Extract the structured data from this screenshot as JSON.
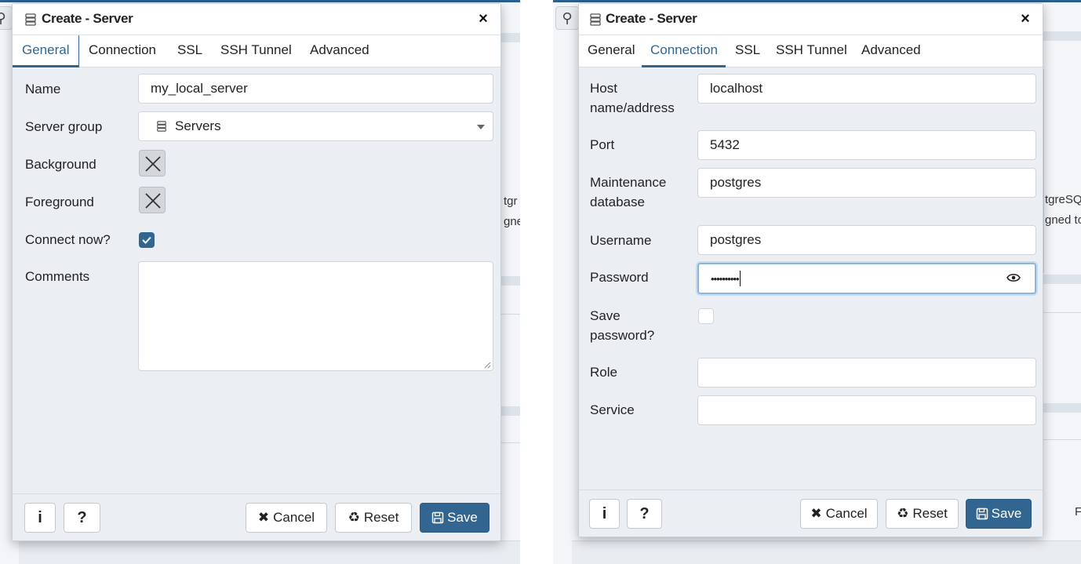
{
  "background": {
    "left_fragments": [
      "tgr",
      "gne"
    ],
    "right_fragments": [
      "tgreSQ",
      "gned to",
      "F"
    ]
  },
  "left_dialog": {
    "title": "Create - Server",
    "close_glyph": "×",
    "tabs": [
      "General",
      "Connection",
      "SSL",
      "SSH Tunnel",
      "Advanced"
    ],
    "active_tab": "General",
    "fields": {
      "name_label": "Name",
      "name_value": "my_local_server",
      "server_group_label": "Server group",
      "server_group_value": "Servers",
      "background_label": "Background",
      "foreground_label": "Foreground",
      "connect_now_label": "Connect now?",
      "connect_now_checked": true,
      "comments_label": "Comments",
      "comments_value": ""
    },
    "footer": {
      "info_label": "i",
      "help_label": "?",
      "cancel_label": "Cancel",
      "reset_label": "Reset",
      "save_label": "Save"
    }
  },
  "right_dialog": {
    "title": "Create - Server",
    "close_glyph": "×",
    "tabs": [
      "General",
      "Connection",
      "SSL",
      "SSH Tunnel",
      "Advanced"
    ],
    "active_tab": "Connection",
    "fields": {
      "host_label_1": "Host",
      "host_label_2": "name/address",
      "host_value": "localhost",
      "port_label": "Port",
      "port_value": "5432",
      "maint_label_1": "Maintenance",
      "maint_label_2": "database",
      "maint_value": "postgres",
      "username_label": "Username",
      "username_value": "postgres",
      "password_label": "Password",
      "password_value": "••••••••••",
      "save_pw_label_1": "Save",
      "save_pw_label_2": "password?",
      "save_password_checked": false,
      "role_label": "Role",
      "role_value": "",
      "service_label": "Service",
      "service_value": ""
    },
    "footer": {
      "info_label": "i",
      "help_label": "?",
      "cancel_label": "Cancel",
      "reset_label": "Reset",
      "save_label": "Save"
    }
  },
  "colors": {
    "accent": "#326690",
    "dialog_bg": "#ebeef3",
    "focus_ring": "#8fb3db"
  },
  "icons": [
    "search-icon",
    "server-icon",
    "close-icon",
    "chevron-down-icon",
    "no-color-x-icon",
    "checkmark-icon",
    "eye-icon",
    "info-icon",
    "help-icon",
    "x-icon",
    "recycle-icon",
    "save-disk-icon",
    "resize-handle-icon"
  ]
}
